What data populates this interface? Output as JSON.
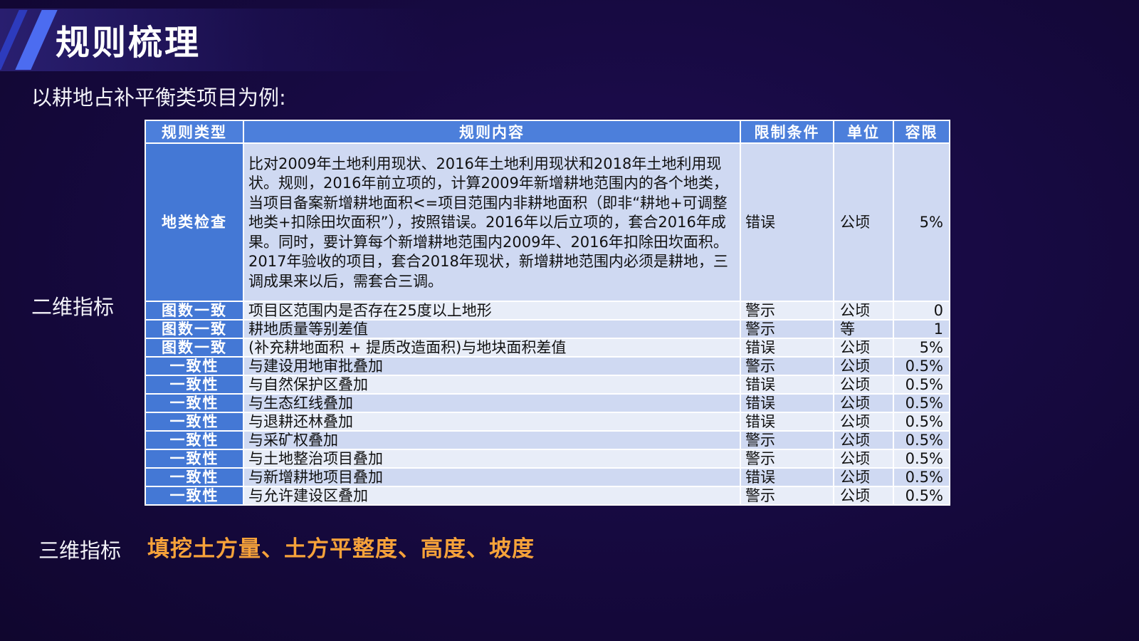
{
  "page_title": "规则梳理",
  "subtitle": "以耕地占补平衡类项目为例:",
  "labels": {
    "two_d": "二维指标",
    "three_d": "三维指标"
  },
  "three_d_metrics": "填挖土方量、土方平整度、高度、坡度",
  "colors": {
    "header_bg": "#4c7fdb",
    "type_col_bg": "#4478d5",
    "row_odd_bg": "#cfd9f2",
    "row_even_bg": "#e8edf8",
    "highlight_text": "#f6a23a"
  },
  "table": {
    "headers": [
      "规则类型",
      "规则内容",
      "限制条件",
      "单位",
      "容限"
    ],
    "rows": [
      {
        "type": "地类检查",
        "content": "比对2009年土地利用现状、2016年土地利用现状和2018年土地利用现状。规则，2016年前立项的，计算2009年新增耕地范围内的各个地类，当项目备案新增耕地面积<=项目范围内非耕地面积（即非“耕地+可调整地类+扣除田坎面积”），按照错误。2016年以后立项的，套合2016年成果。同时，要计算每个新增耕地范围内2009年、2016年扣除田坎面积。2017年验收的项目，套合2018年现状，新增耕地范围内必须是耕地，三调成果来以后，需套合三调。",
        "condition": "错误",
        "unit": "公顷",
        "tolerance": "5%"
      },
      {
        "type": "图数一致",
        "content": "项目区范围内是否存在25度以上地形",
        "condition": "警示",
        "unit": "公顷",
        "tolerance": "0"
      },
      {
        "type": "图数一致",
        "content": "耕地质量等别差值",
        "condition": "警示",
        "unit": "等",
        "tolerance": "1"
      },
      {
        "type": "图数一致",
        "content": "(补充耕地面积 + 提质改造面积)与地块面积差值",
        "condition": "错误",
        "unit": "公顷",
        "tolerance": "5%"
      },
      {
        "type": "一致性",
        "content": "与建设用地审批叠加",
        "condition": "警示",
        "unit": "公顷",
        "tolerance": "0.5%"
      },
      {
        "type": "一致性",
        "content": "与自然保护区叠加",
        "condition": "错误",
        "unit": "公顷",
        "tolerance": "0.5%"
      },
      {
        "type": "一致性",
        "content": "与生态红线叠加",
        "condition": "错误",
        "unit": "公顷",
        "tolerance": "0.5%"
      },
      {
        "type": "一致性",
        "content": "与退耕还林叠加",
        "condition": "错误",
        "unit": "公顷",
        "tolerance": "0.5%"
      },
      {
        "type": "一致性",
        "content": "与采矿权叠加",
        "condition": "警示",
        "unit": "公顷",
        "tolerance": "0.5%"
      },
      {
        "type": "一致性",
        "content": "与土地整治项目叠加",
        "condition": "警示",
        "unit": "公顷",
        "tolerance": "0.5%"
      },
      {
        "type": "一致性",
        "content": "与新增耕地项目叠加",
        "condition": "错误",
        "unit": "公顷",
        "tolerance": "0.5%"
      },
      {
        "type": "一致性",
        "content": "与允许建设区叠加",
        "condition": "警示",
        "unit": "公顷",
        "tolerance": "0.5%"
      }
    ]
  }
}
